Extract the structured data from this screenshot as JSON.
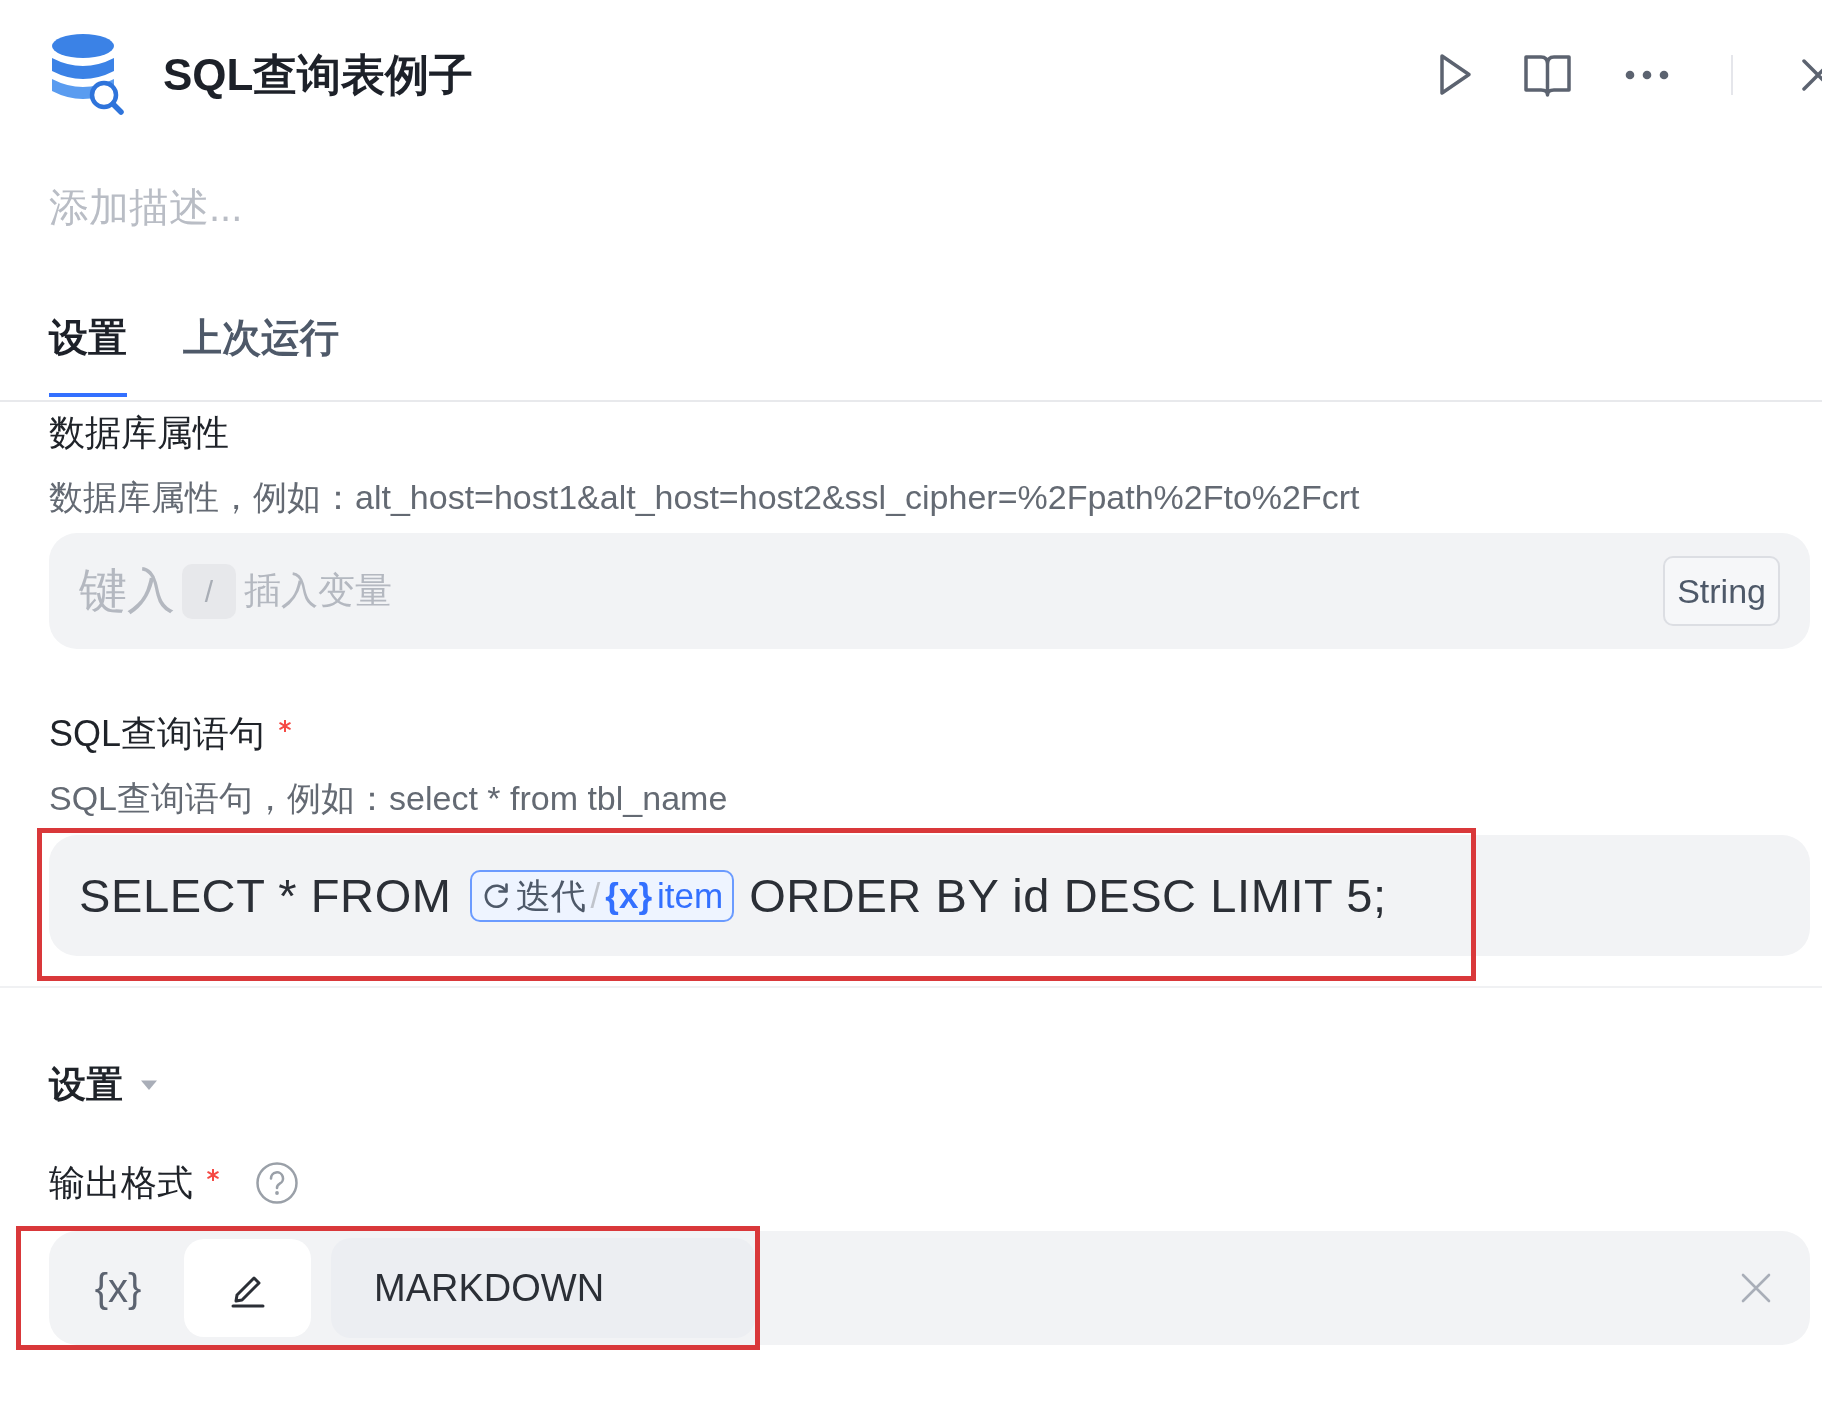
{
  "header": {
    "title": "SQL查询表例子"
  },
  "description": {
    "placeholder": "添加描述..."
  },
  "tabs": [
    {
      "label": "设置",
      "selected": true
    },
    {
      "label": "上次运行",
      "selected": false
    }
  ],
  "fields": [
    {
      "kind": "text",
      "label": "数据库属性",
      "hint": "数据库属性，例如：alt_host=host1&alt_host=host2&ssl_cipher=%2Fpath%2Fto%2Fcrt",
      "placeholder": "键入",
      "shortcut_key": "/",
      "shortcut_hint": "插入变量",
      "type": "String"
    },
    {
      "kind": "query",
      "label": "SQL查询语句",
      "required": true,
      "hint": "SQL查询语句，例如：select * from tbl_name",
      "highlighted": true,
      "value": [
        {
          "kind": "text",
          "text": "SELECT * FROM"
        },
        {
          "kind": "variable",
          "node": "迭代",
          "separator": "/",
          "symbol": "{x}",
          "name": "item"
        },
        {
          "kind": "text",
          "text": "ORDER BY id DESC LIMIT 5;"
        }
      ]
    }
  ],
  "section": {
    "title": "设置",
    "expanded": true,
    "fields": [
      {
        "kind": "mode",
        "label": "输出格式",
        "required": true,
        "help": true,
        "modes": [
          {
            "kind": "variable",
            "symbol": "{x}",
            "selected": false
          },
          {
            "kind": "constant",
            "selected": true
          }
        ],
        "value": "MARKDOWN",
        "clearable": true,
        "highlighted": true
      }
    ]
  }
}
